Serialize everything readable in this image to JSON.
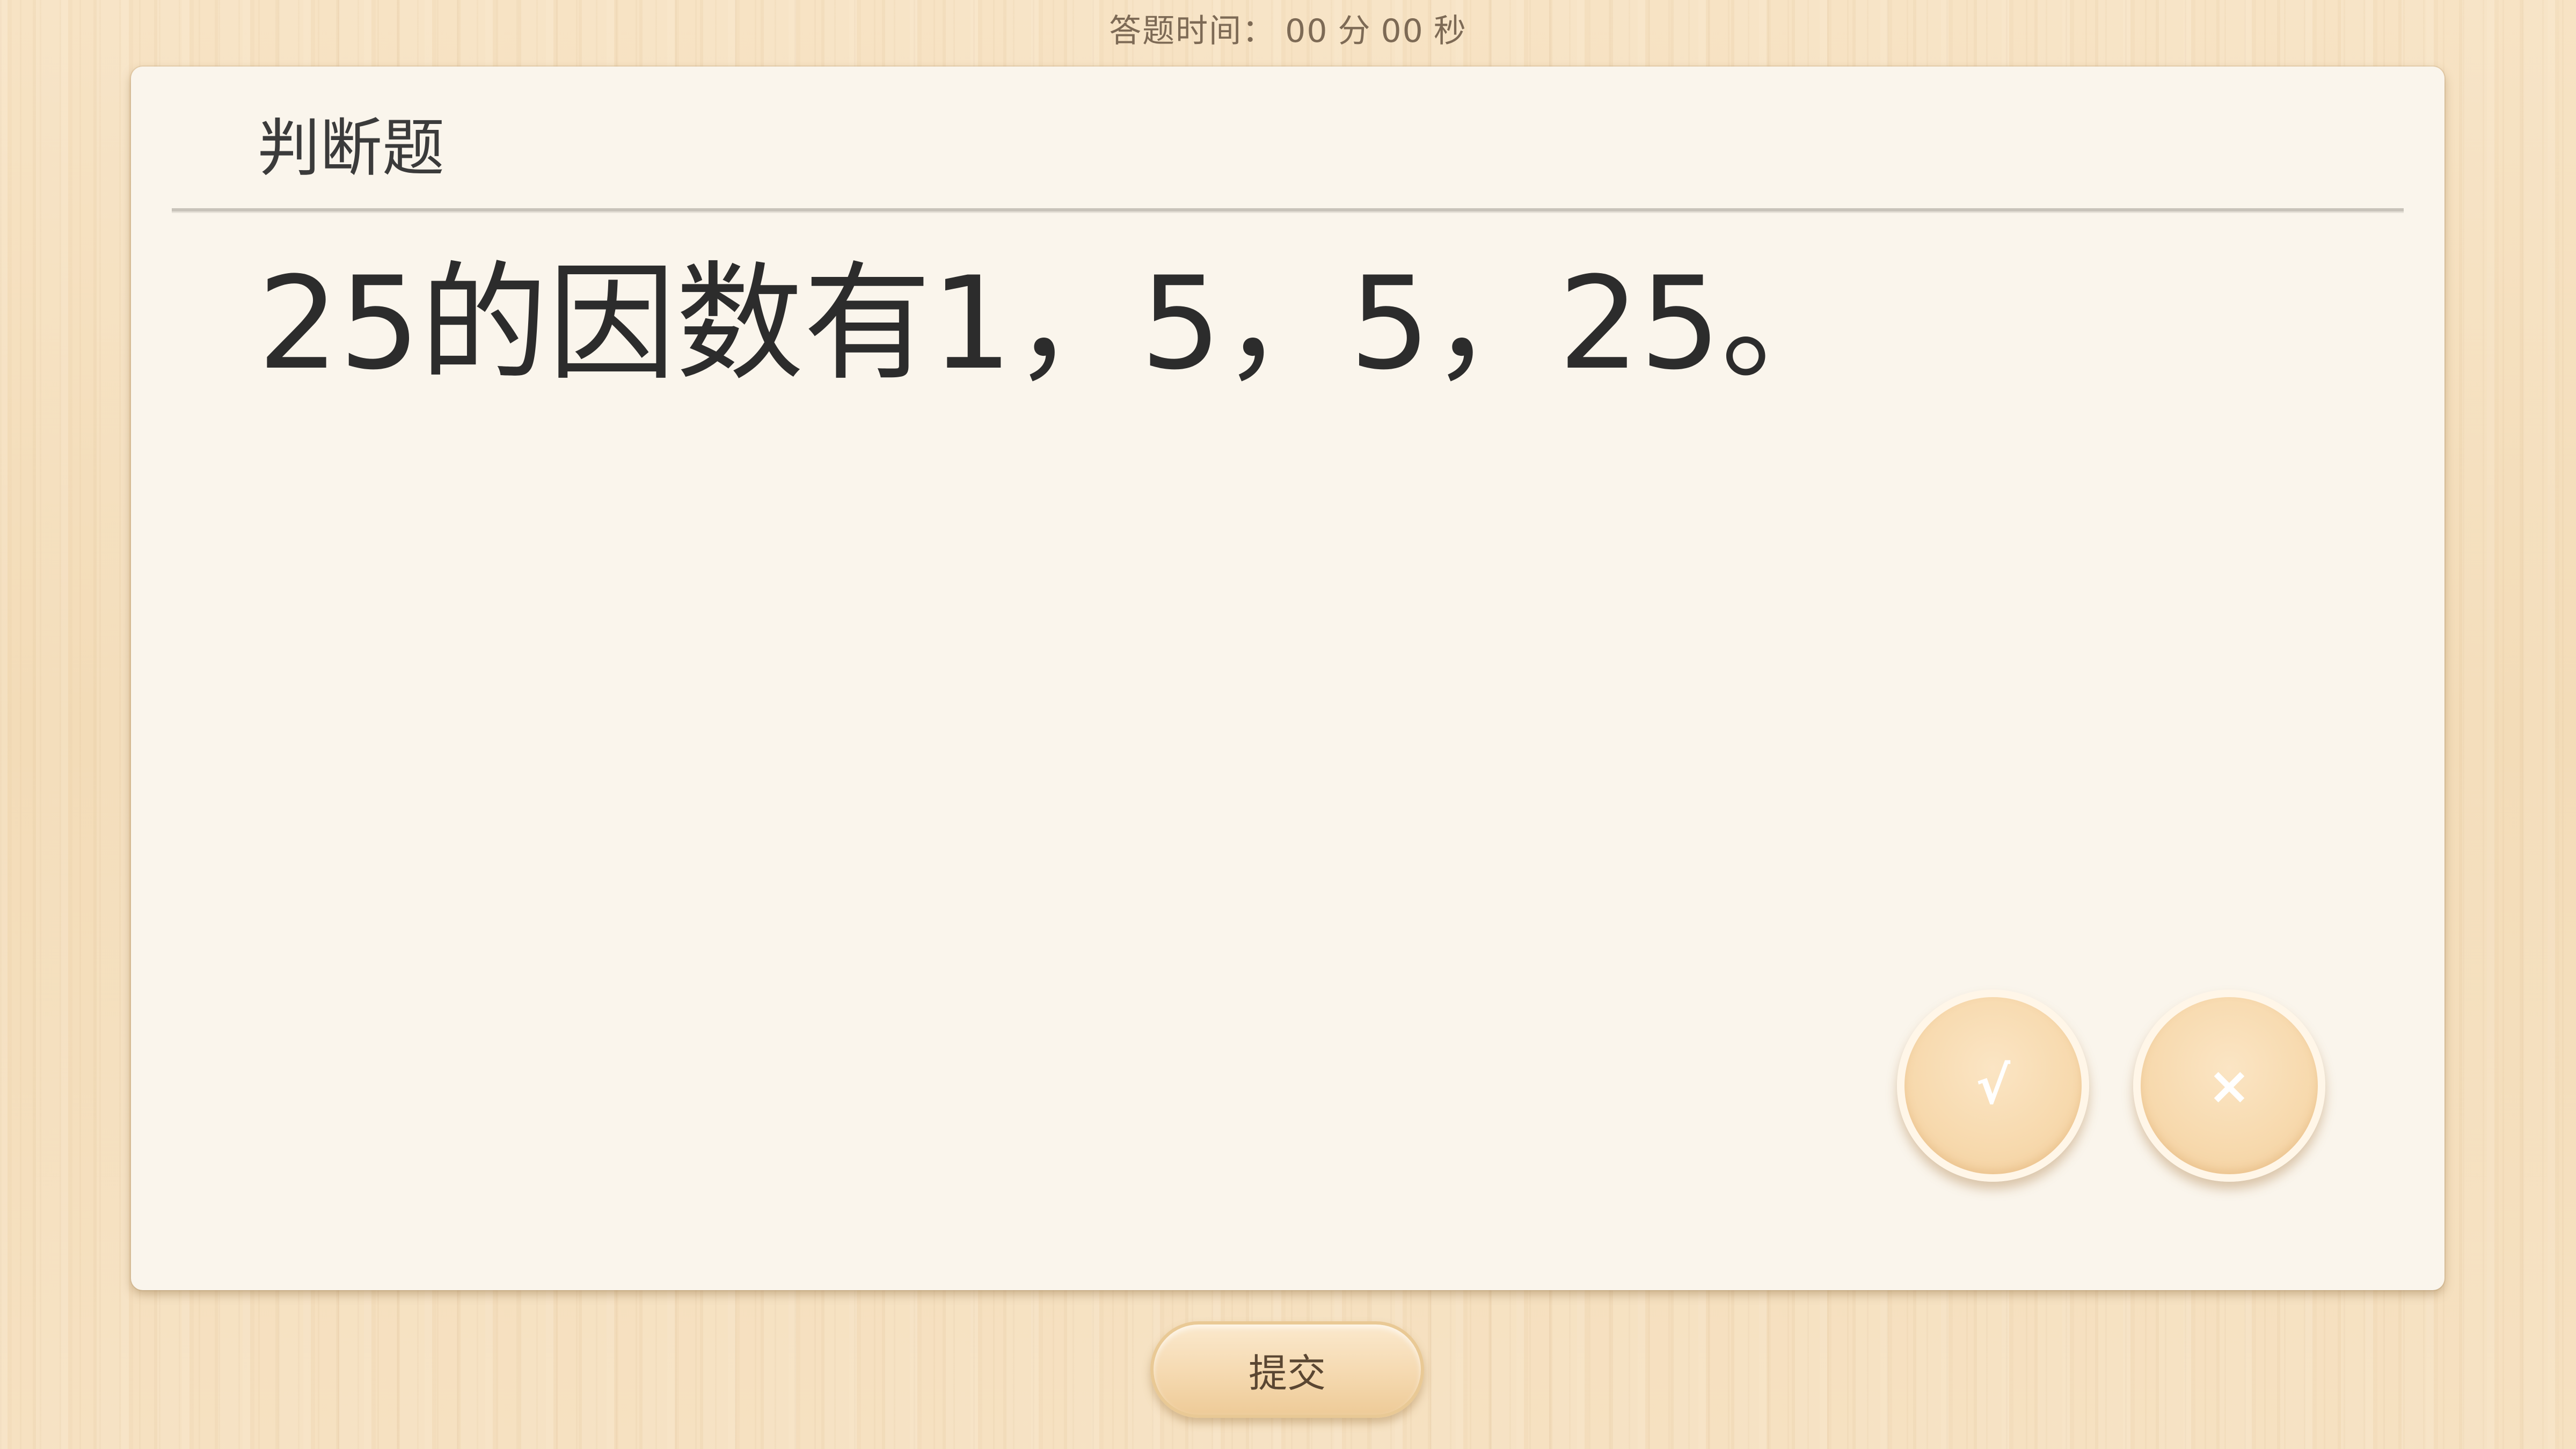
{
  "timer": {
    "label": "答题时间：",
    "minutes": "00",
    "minutes_unit": "分",
    "seconds": "00",
    "seconds_unit": "秒"
  },
  "card": {
    "header": "判断题",
    "question": "25的因数有1，5，5，25。"
  },
  "answers": {
    "true_label": "√",
    "false_label": "×"
  },
  "submit": {
    "label": "提交"
  },
  "colors": {
    "background": "#f5dfbd",
    "card": "#faf5ec",
    "button": "#f7d9ad"
  }
}
